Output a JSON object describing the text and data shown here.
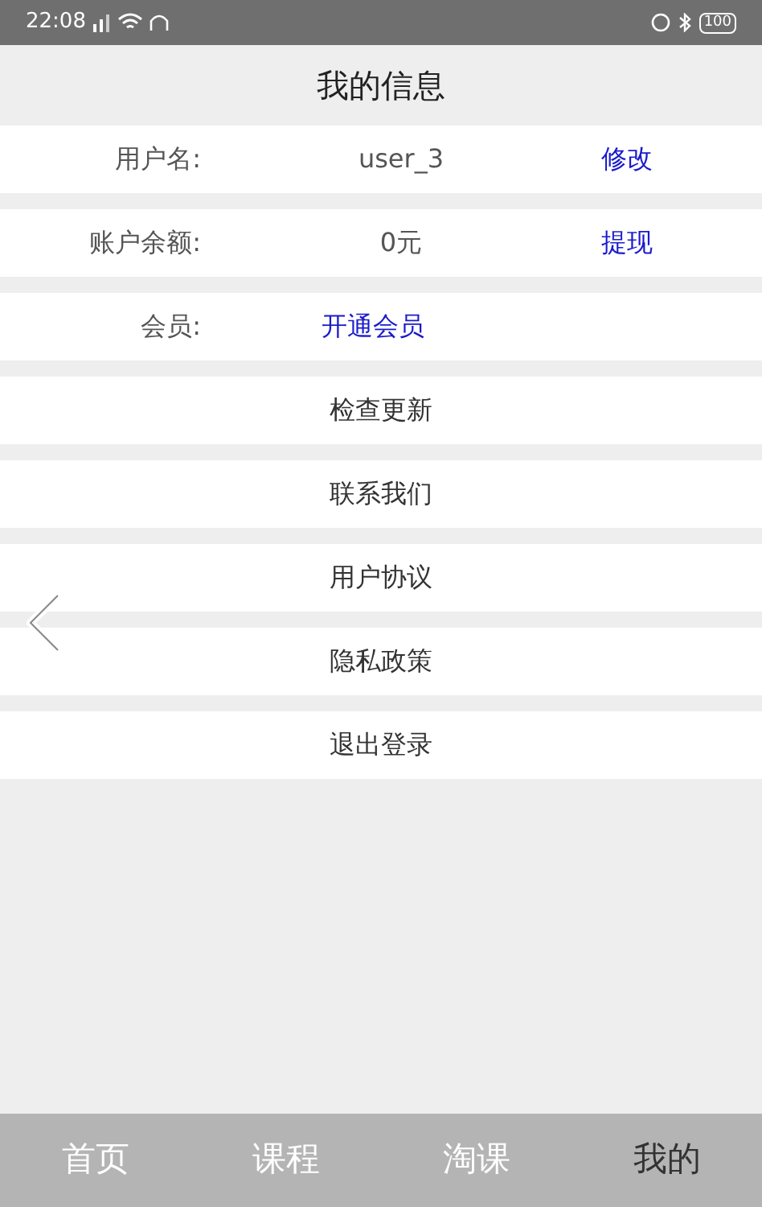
{
  "status_bar": {
    "time": "22:08",
    "battery": "100"
  },
  "title": "我的信息",
  "info_rows": [
    {
      "label": "用户名:",
      "value": "user_3",
      "action": "修改"
    },
    {
      "label": "账户余额:",
      "value": "0元",
      "action": "提现"
    },
    {
      "label": "会员:",
      "link": "开通会员"
    }
  ],
  "menu_items": [
    "检查更新",
    "联系我们",
    "用户协议",
    "隐私政策",
    "退出登录"
  ],
  "tabs": [
    {
      "label": "首页",
      "selected": false
    },
    {
      "label": "课程",
      "selected": false
    },
    {
      "label": "淘课",
      "selected": false
    },
    {
      "label": "我的",
      "selected": true
    }
  ]
}
